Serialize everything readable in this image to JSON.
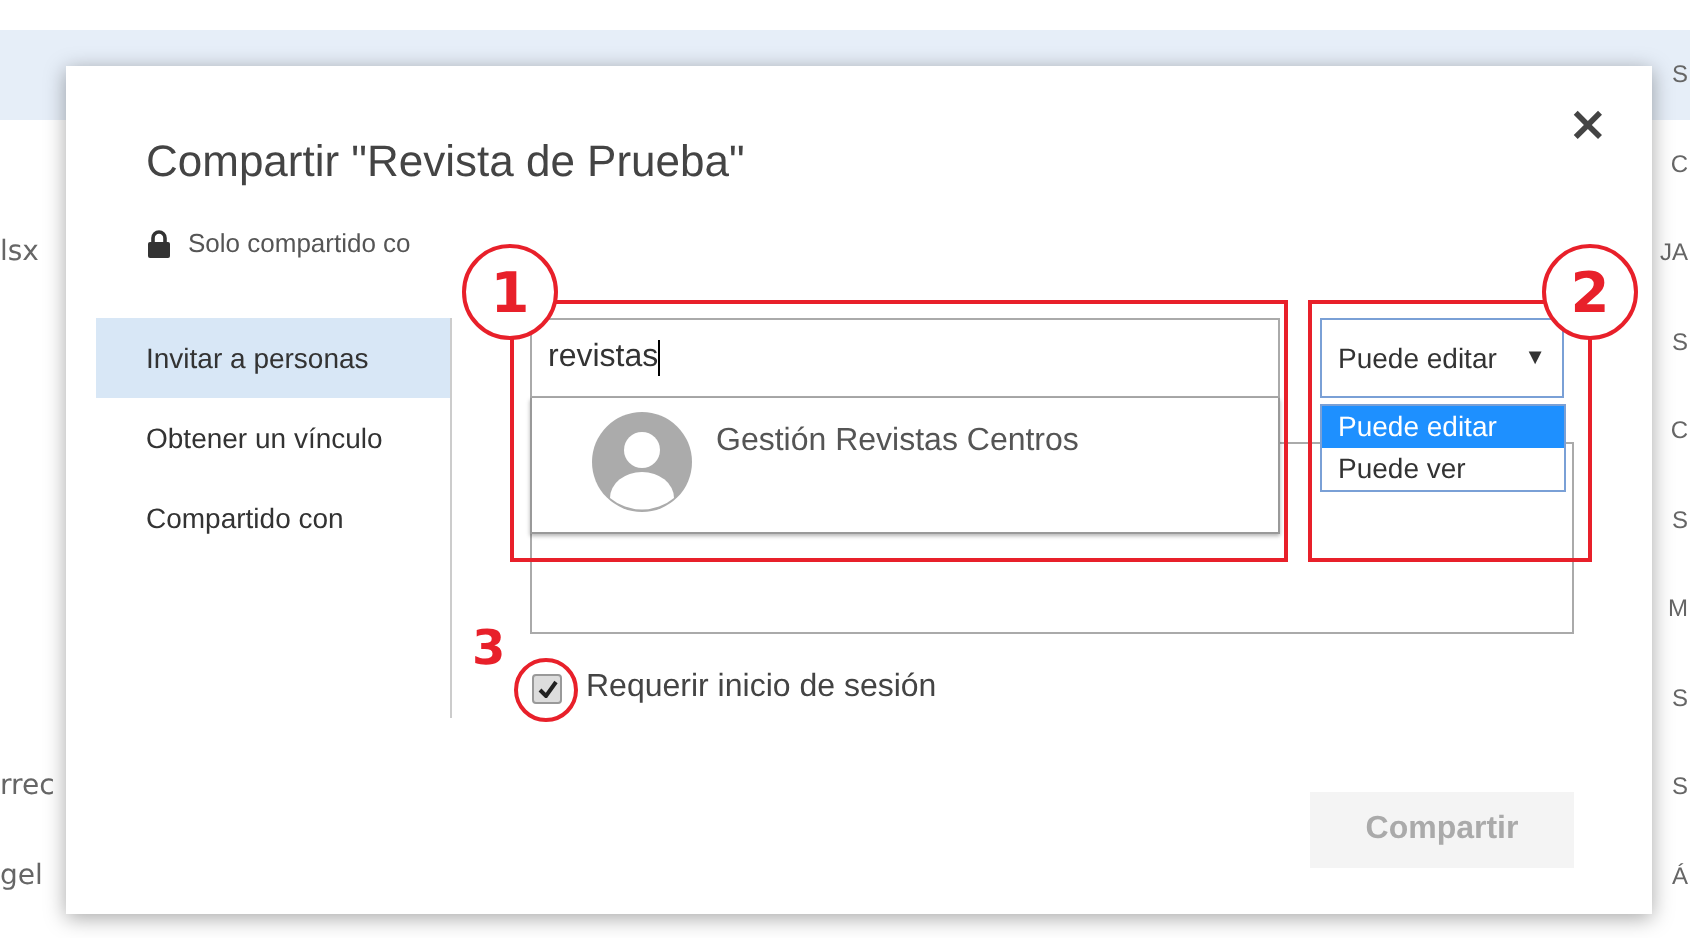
{
  "background_rows": [
    {
      "right": "S",
      "selected": true
    },
    {
      "right": "C",
      "selected": false
    },
    {
      "left": "lsx",
      "right": "JA",
      "selected": false
    },
    {
      "right": "S",
      "selected": false
    },
    {
      "right": "C",
      "selected": false
    },
    {
      "right": "S",
      "selected": false
    },
    {
      "right": "M",
      "selected": false
    },
    {
      "right": "S",
      "selected": false
    },
    {
      "left": "rrec",
      "right": "S",
      "selected": false
    },
    {
      "left": "gel",
      "right": "Á",
      "selected": false
    }
  ],
  "dialog": {
    "title": "Compartir \"Revista de Prueba\"",
    "close": "×",
    "sharing_note": "Solo compartido co",
    "nav": [
      {
        "label": "Invitar a personas",
        "selected": true
      },
      {
        "label": "Obtener un vínculo",
        "selected": false
      },
      {
        "label": "Compartido con",
        "selected": false
      }
    ],
    "people_field": {
      "value": "revistas"
    },
    "suggestions": [
      {
        "name": "Gestión Revistas Centros"
      }
    ],
    "permission": {
      "value": "Puede editar",
      "arrow": "▼",
      "options": [
        {
          "label": "Puede editar",
          "selected": true
        },
        {
          "label": "Puede ver",
          "selected": false
        }
      ]
    },
    "require_signin": {
      "label": "Requerir inicio de sesión",
      "checked": true
    },
    "share_button": {
      "label": "Compartir",
      "disabled": true
    }
  },
  "annotations": [
    {
      "label": "1"
    },
    {
      "label": "2"
    },
    {
      "label": "3"
    }
  ]
}
